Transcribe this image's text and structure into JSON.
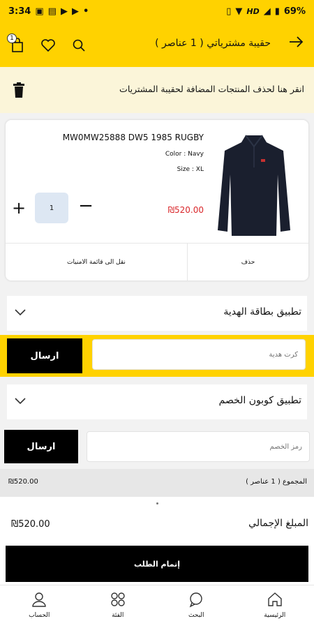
{
  "status_bar": {
    "time": "3:34",
    "battery": "69%",
    "network": "HD",
    "left_icons": [
      "image-icon",
      "news-icon",
      "youtube-icon",
      "youtube-icon",
      "dot-icon"
    ],
    "right_icons": [
      "vibrate-icon",
      "wifi-icon",
      "signal-icon",
      "battery-icon"
    ]
  },
  "header": {
    "title": "حقيبة مشترياتي ( 1 عناصر )",
    "cart_count": "1",
    "back_icon": "arrow-right-icon",
    "icons": [
      "cart-icon",
      "heart-icon",
      "search-icon"
    ]
  },
  "notice": {
    "text": "انقر هنا لحذف المنتجات المضافة لحقيبة المشتريات",
    "icon": "trash-icon"
  },
  "product": {
    "name": "MW0MW25888 DW5 1985 RUGBY",
    "color": "Color : Navy",
    "size": "Size : XL",
    "price": "₪520.00",
    "quantity": "1",
    "delete_label": "حذف",
    "move_to_wishlist_label": "نقل الى قائمة الامنيات"
  },
  "gift_card": {
    "title": "تطبيق بطاقة الهدية",
    "placeholder": "كرت هدية",
    "send_label": "ارسال"
  },
  "coupon": {
    "title": "تطبيق كوبون الخصم",
    "placeholder": "رمز الخصم",
    "send_label": "ارسال"
  },
  "summary": {
    "subtotal_label": "المجموع ( 1 عناصر )",
    "subtotal_value": "₪520.00",
    "total_label": "المبلغ الإجمالي",
    "total_value": "₪520.00"
  },
  "checkout": {
    "label": "إتمام الطلب"
  },
  "bottom_nav": {
    "items": [
      {
        "label": "الرئيسية",
        "icon": "home-icon"
      },
      {
        "label": "البحث",
        "icon": "chat-search-icon"
      },
      {
        "label": "الفئة",
        "icon": "grid-icon"
      },
      {
        "label": "الحساب",
        "icon": "user-icon"
      }
    ]
  },
  "colors": {
    "accent": "#ffd200",
    "price": "#d9262a",
    "notice_bg": "#fbf5d9"
  }
}
